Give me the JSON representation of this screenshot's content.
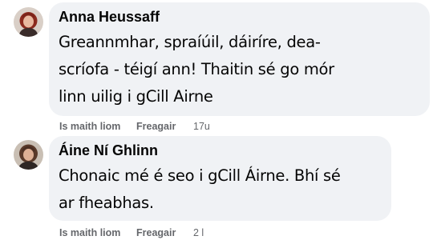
{
  "comments": [
    {
      "author": "Anna Heussaff",
      "text": "Greannmhar, spraíúil, dáiríre, dea-scríofa - téigí ann! Thaitin sé go mór linn uilig i gCill Airne",
      "text_lines": [
        "Greannmhar, spraíúil, dáiríre, dea-",
        "scríofa - téigí ann! Thaitin sé go mór",
        "linn uilig i gCill Airne"
      ],
      "like_label": "Is maith liom",
      "reply_label": "Freagair",
      "timestamp": "17u",
      "avatar_icon": "profile-photo-icon"
    },
    {
      "author": "Áine Ní Ghlinn",
      "text": "Chonaic mé é seo i gCill Áirne. Bhí sé ar fheabhas.",
      "text_lines": [
        "Chonaic mé é seo i gCill Áirne. Bhí sé",
        "ar fheabhas."
      ],
      "like_label": "Is maith liom",
      "reply_label": "Freagair",
      "timestamp": "2 l",
      "avatar_icon": "profile-photo-icon"
    }
  ],
  "colors": {
    "bubble_bg": "#f0f2f5",
    "text": "#050505",
    "secondary_text": "#65676b",
    "page_bg": "#ffffff"
  }
}
